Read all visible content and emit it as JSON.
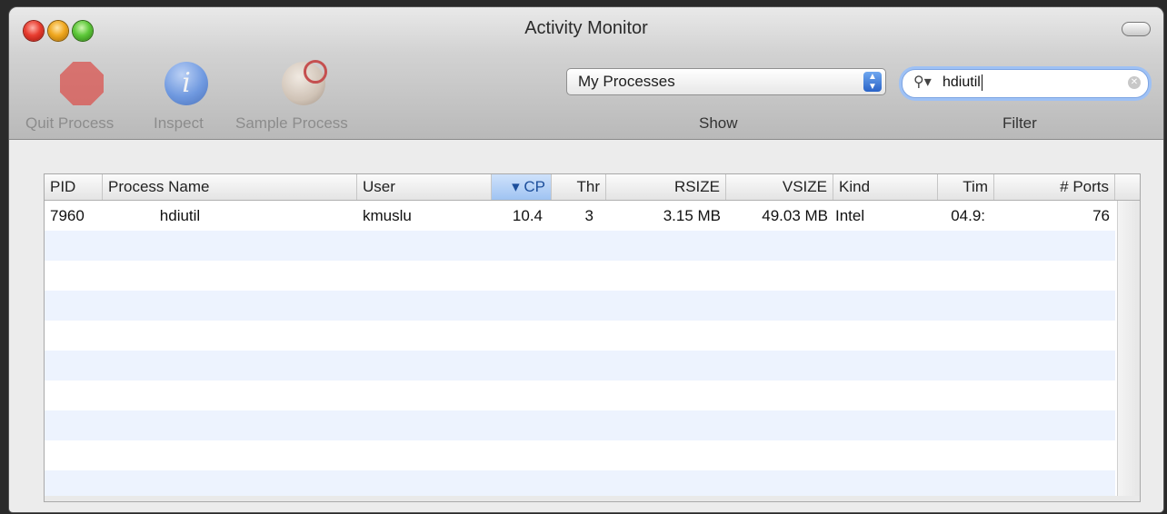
{
  "window": {
    "title": "Activity Monitor"
  },
  "toolbar": {
    "quit_label": "Quit Process",
    "inspect_label": "Inspect",
    "sample_label": "Sample Process",
    "show_select_value": "My Processes",
    "show_label": "Show",
    "filter_value": "hdiutil",
    "filter_label": "Filter"
  },
  "table": {
    "columns": [
      {
        "label": "PID"
      },
      {
        "label": "Process Name"
      },
      {
        "label": "User"
      },
      {
        "label": "▾ CP"
      },
      {
        "label": "Thr"
      },
      {
        "label": "RSIZE"
      },
      {
        "label": "VSIZE"
      },
      {
        "label": "Kind"
      },
      {
        "label": "Tim"
      },
      {
        "label": "# Ports"
      }
    ],
    "rows": [
      {
        "pid": "7960",
        "name": "hdiutil",
        "user": "kmuslu",
        "cpu": "10.4",
        "threads": "3",
        "rsize": "3.15 MB",
        "vsize": "49.03 MB",
        "kind": "Intel",
        "time": "04.9:",
        "ports": "76"
      }
    ]
  },
  "colors": {
    "accent": "#9fc3f2",
    "alt_row": "#edf3fe"
  }
}
